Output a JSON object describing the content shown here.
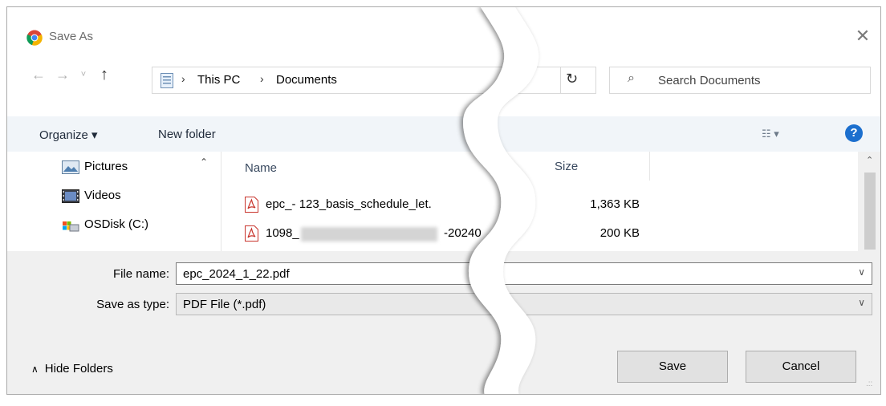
{
  "window": {
    "title": "Save As",
    "close_glyph": "✕"
  },
  "address": {
    "crumbs": [
      "This PC",
      "Documents"
    ],
    "separator": "›",
    "refresh_glyph": "↻",
    "search_placeholder": "Search Documents"
  },
  "toolbar": {
    "organize_label": "Organize ▾",
    "new_folder_label": "New folder",
    "view_glyph": "☷ ▾",
    "help_glyph": "?"
  },
  "nav_pane": {
    "items": [
      {
        "label": "Pictures",
        "icon": "pictures-icon"
      },
      {
        "label": "Videos",
        "icon": "videos-icon"
      },
      {
        "label": "OSDisk (C:)",
        "icon": "drive-icon"
      }
    ]
  },
  "file_list": {
    "columns": {
      "name": "Name",
      "size": "Size"
    },
    "rows": [
      {
        "name": "epc_- 123_basis_schedule_let.",
        "size": "1,363 KB",
        "icon": "pdf-file-icon"
      },
      {
        "name": "1098_",
        "name_suffix": "-20240",
        "size": "200 KB",
        "icon": "pdf-file-icon",
        "redacted": true
      }
    ]
  },
  "form": {
    "file_name_label": "File name:",
    "file_name_value": "epc_2024_1_22.pdf",
    "save_type_label": "Save as type:",
    "save_type_value": "PDF File (*.pdf)"
  },
  "footer": {
    "hide_folders_label": "Hide Folders",
    "save_label": "Save",
    "cancel_label": "Cancel"
  },
  "colors": {
    "accent": "#1c6fce",
    "toolbar_bg": "#f1f5f9",
    "footer_bg": "#f0f0f0"
  }
}
